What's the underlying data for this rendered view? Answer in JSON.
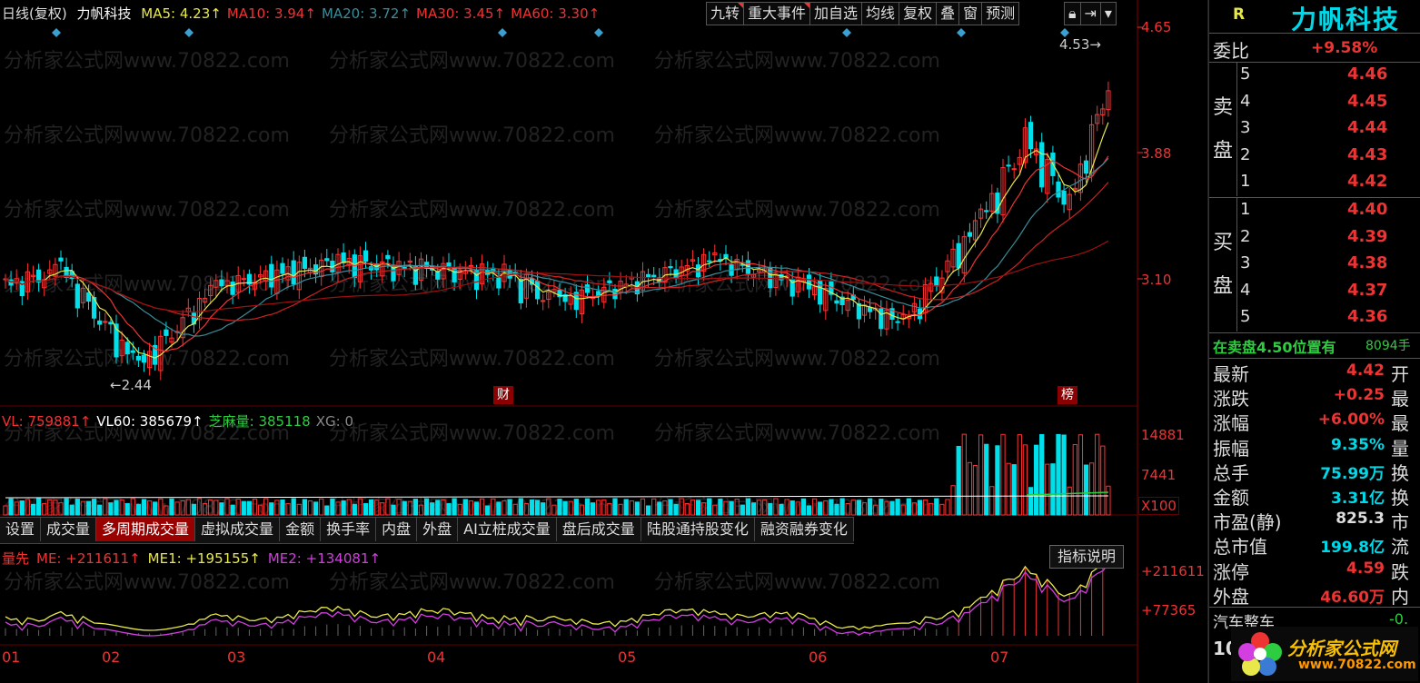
{
  "toolbar": {
    "period_label": "日线(复权)",
    "stock_name": "力帆科技",
    "ma": [
      {
        "label": "MA5: 4.23↑",
        "color": "#e8e84a"
      },
      {
        "label": "MA10: 3.94↑",
        "color": "#e33"
      },
      {
        "label": "MA20: 3.72↑",
        "color": "#3a8c9a"
      },
      {
        "label": "MA30: 3.45↑",
        "color": "#e33"
      },
      {
        "label": "MA60: 3.30↑",
        "color": "#e33"
      }
    ],
    "buttons": [
      "九转",
      "重大事件",
      "加自选",
      "均线",
      "复权",
      "叠",
      "窗",
      "预测"
    ]
  },
  "price_axis": {
    "top": "4.65",
    "mid1": "3.88",
    "mid2": "3.10"
  },
  "annotations": {
    "high": "4.53",
    "low": "2.44",
    "fin_badge": "财",
    "rank_badge": "榜"
  },
  "watermark": "分析家公式网www.70822.com",
  "volume": {
    "indicator_line": [
      {
        "text": "VL: 759881↑",
        "color": "#e33"
      },
      {
        "text": "VL60: 385679↑",
        "color": "#fff"
      },
      {
        "text": "芝麻量: 385118",
        "color": "#2ecc40"
      },
      {
        "text": "XG: 0",
        "color": "#888"
      }
    ],
    "axis_top": "14881",
    "axis_mid": "7441",
    "axis_unit": "X100"
  },
  "tabs": [
    "设置",
    "成交量",
    "多周期成交量",
    "虚拟成交量",
    "金额",
    "换手率",
    "内盘",
    "外盘",
    "AI立桩成交量",
    "盘后成交量",
    "陆股通持股变化",
    "融资融券变化"
  ],
  "active_tab": "多周期成交量",
  "indicator": {
    "name": "量先",
    "values": [
      {
        "text": "ME: +211611↑",
        "color": "#e33"
      },
      {
        "text": "ME1: +195155↑",
        "color": "#e8e84a"
      },
      {
        "text": "ME2: +134081↑",
        "color": "#d23ee0"
      }
    ],
    "help_button": "指标说明",
    "axis_top": "+211611",
    "axis_mid": "+77365"
  },
  "months": [
    "01",
    "02",
    "03",
    "04",
    "05",
    "06",
    "07"
  ],
  "right_panel": {
    "r_label": "R",
    "title": "力帆科技",
    "weibi_label": "委比",
    "weibi_value": "+9.58%",
    "sell_label": "卖盘",
    "buy_label": "买盘",
    "sell": [
      {
        "level": "5",
        "price": "4.46"
      },
      {
        "level": "4",
        "price": "4.45"
      },
      {
        "level": "3",
        "price": "4.44"
      },
      {
        "level": "2",
        "price": "4.43"
      },
      {
        "level": "1",
        "price": "4.42"
      }
    ],
    "buy": [
      {
        "level": "1",
        "price": "4.40"
      },
      {
        "level": "2",
        "price": "4.39"
      },
      {
        "level": "3",
        "price": "4.38"
      },
      {
        "level": "4",
        "price": "4.37"
      },
      {
        "level": "5",
        "price": "4.36"
      }
    ],
    "notice_left": "在卖盘4.50位置有",
    "notice_right": "8094手",
    "stats": [
      {
        "label": "最新",
        "value": "4.42",
        "extra": "开",
        "color": "#e33"
      },
      {
        "label": "涨跌",
        "value": "+0.25",
        "extra": "最",
        "color": "#e33"
      },
      {
        "label": "涨幅",
        "value": "+6.00%",
        "extra": "最",
        "color": "#e33"
      },
      {
        "label": "振幅",
        "value": "9.35%",
        "extra": "量",
        "color": "#00d8e8"
      },
      {
        "label": "总手",
        "value": "75.99万",
        "extra": "换",
        "color": "#00d8e8"
      },
      {
        "label": "金额",
        "value": "3.31亿",
        "extra": "换",
        "color": "#00d8e8"
      },
      {
        "label": "市盈(静)",
        "value": "825.3",
        "extra": "市",
        "color": "#ddd"
      },
      {
        "label": "总市值",
        "value": "199.8亿",
        "extra": "流",
        "color": "#00d8e8"
      },
      {
        "label": "涨停",
        "value": "4.59",
        "extra": "跌",
        "color": "#e33"
      },
      {
        "label": "外盘",
        "value": "46.60万",
        "extra": "内",
        "color": "#e33"
      }
    ],
    "sector": "汽车整车",
    "sector_value": "-0.",
    "bottom_num": "10",
    "logo_text": "分析家公式网",
    "logo_url": "www.70822.com"
  }
}
